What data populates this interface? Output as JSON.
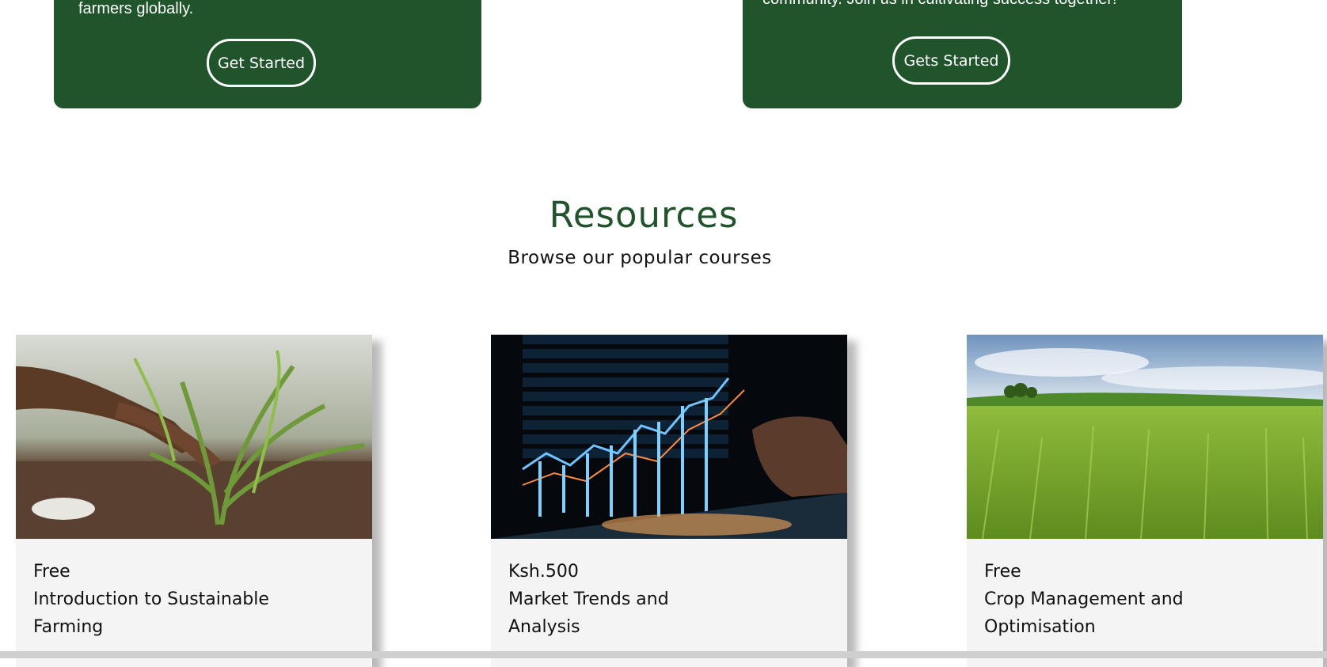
{
  "promos": [
    {
      "text": "farmers globally.",
      "button_label": "Get Started"
    },
    {
      "text": "community. Join us in cultivating success together!",
      "button_label": "Gets Started"
    }
  ],
  "resources": {
    "title": "Resources",
    "subtitle": "Browse our popular courses"
  },
  "courses": [
    {
      "price": "Free",
      "title": "Introduction to Sustainable Farming",
      "image": "hands-planting-seedling"
    },
    {
      "price": "Ksh.500",
      "title": "Market Trends and Analysis",
      "image": "financial-chart-hologram"
    },
    {
      "price": "Free",
      "title": "Crop Management and Optimisation",
      "image": "green-wheat-field"
    }
  ],
  "colors": {
    "brand_green": "#20542b",
    "card_bg": "#f4f4f4"
  }
}
